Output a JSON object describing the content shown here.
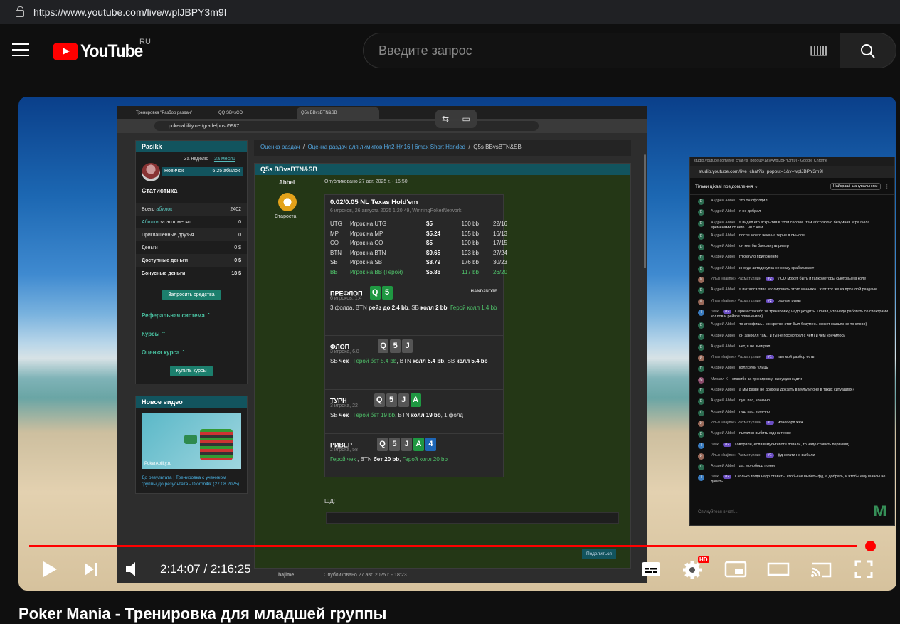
{
  "browser": {
    "url": "https://www.youtube.com/live/wplJBPY3m9I"
  },
  "header": {
    "logo": "YouTube",
    "region": "RU",
    "search_placeholder": "Введите запрос"
  },
  "video": {
    "title": "Poker Mania - Тренировка для младшей группы",
    "current_time": "2:14:07",
    "duration": "2:16:25",
    "time_display": "2:14:07 / 2:16:25",
    "progress_fraction": 0.984,
    "hd_badge": "HD"
  },
  "screen": {
    "tabs": [
      "Тренировка \"Разбор раздач\"",
      "QQ SBvsCO",
      "Q5s BBvsBTN&SB"
    ],
    "address": "pokerability.net/grade/post/5987",
    "profile": {
      "name": "Pasikk",
      "period_week": "За неделю",
      "period_month": "За месяц",
      "rank": "Новичок",
      "abilok": "6.25 абилок",
      "stats_title": "Статистика",
      "stats": [
        {
          "label": "Всего абилок",
          "value": "2402"
        },
        {
          "label": "Абилки за этот месяц",
          "value": "0"
        },
        {
          "label": "Приглашенные друзья",
          "value": "0"
        },
        {
          "label": "Деньги",
          "value": "0 $"
        },
        {
          "label": "Доступные деньги",
          "value": "0 $"
        },
        {
          "label": "Бонусные деньги",
          "value": "18 $"
        }
      ],
      "request_btn": "Запросить средства",
      "menu": [
        "Реферальная система",
        "Курсы",
        "Оценка курса"
      ],
      "buy_btn": "Купить курсы"
    },
    "newvideo": {
      "heading": "Новое видео",
      "logo_text": "PokerAbility.ru",
      "caption": "До результата | Тренировка с учеником группы До результата - Dioron4ik (27.08.2025)"
    },
    "breadcrumb": [
      "Оценка раздач",
      "Оценка раздач для лимитов Нл2-Нл16 | 6max Short Handed",
      "Q5s BBvsBTN&SB"
    ],
    "post": {
      "title": "Q5s BBvsBTN&SB",
      "author": "Abbel",
      "author_role": "Староста",
      "published": "Опубликовано 27 авг. 2025 г. - 16:50",
      "hand_title": "0.02/0.05 NL Texas Hold'em",
      "hand_info": "6 игроков, 26 августа 2025 1:20:49, WinningPokerNetwork",
      "players": [
        {
          "pos": "UTG",
          "name": "Игрок на UTG",
          "stack": "$5",
          "bb": "100 bb",
          "ratio": "22/16"
        },
        {
          "pos": "MP",
          "name": "Игрок на MP",
          "stack": "$5.24",
          "bb": "105 bb",
          "ratio": "16/13"
        },
        {
          "pos": "CO",
          "name": "Игрок на CO",
          "stack": "$5",
          "bb": "100 bb",
          "ratio": "17/15"
        },
        {
          "pos": "BTN",
          "name": "Игрок на BTN",
          "stack": "$9.65",
          "bb": "193 bb",
          "ratio": "27/24"
        },
        {
          "pos": "SB",
          "name": "Игрок на SB",
          "stack": "$8.79",
          "bb": "176 bb",
          "ratio": "30/23"
        },
        {
          "pos": "BB",
          "name": "Игрок на BB (Герой)",
          "stack": "$5.86",
          "bb": "117 bb",
          "ratio": "26/20"
        }
      ],
      "preflop": {
        "label": "ПРЕФЛОП",
        "sub": "6 игроков, 1.4",
        "cards": [
          "Q",
          "5"
        ],
        "brand": "HAND2NOTE",
        "action": "3 фолда, BTN рейз до 2.4 bb, SB колл 2 bb, Герой колл 1.4 bb"
      },
      "flop": {
        "label": "ФЛОП",
        "sub": "3 игрока, 6.8",
        "cards": [
          "Q",
          "5",
          "J"
        ],
        "action": "SB чек , Герой бет 5.4 bb, BTN колл 5.4 bb, SB колл 5.4 bb"
      },
      "turn": {
        "label": "ТУРН",
        "sub": "3 игрока, 22",
        "cards": [
          "Q",
          "5",
          "J",
          "A"
        ],
        "action": "SB чек , Герой бет 19 bb, BTN колл 19 bb, 1 фолд"
      },
      "river": {
        "label": "РИВЕР",
        "sub": "2 игрока, 58",
        "cards": [
          "Q",
          "5",
          "J",
          "A",
          "4"
        ],
        "action": "Герой чек , BTN бет 20 bb, Герой колл 20 bb"
      },
      "sd_label": "ШД:",
      "share_btn": "Поделиться",
      "next_author": "hajime",
      "next_published": "Опубликовано 27 авг. 2025 г. - 18:23"
    }
  },
  "chat": {
    "window_title": "studio.youtube.com/live_chat?is_popout=1&v=wplJBPY3m9I - Google Chrome",
    "url": "studio.youtube.com/live_chat?is_popout=1&v=wplJBPY3m9I",
    "filter": "Тільки цікаві повідомлення",
    "top_btn": "Найкращі шанувальники",
    "input_placeholder": "Спілкуйтеся в чаті...",
    "messages": [
      {
        "i": "D",
        "a": "Андрей Abbel",
        "t": "это он сфолдил"
      },
      {
        "i": "D",
        "a": "Андрей Abbel",
        "t": "я не добрал"
      },
      {
        "i": "D",
        "a": "Андрей Abbel",
        "t": "я видел его вскрытия в этой сессии.. там абсолютно безумная игра была временами от него.. ни с чем"
      },
      {
        "i": "D",
        "a": "Андрей Abbel",
        "t": "после моего чека на терне в смысле"
      },
      {
        "i": "D",
        "a": "Андрей Abbel",
        "t": "он мог бы блефануть ривер"
      },
      {
        "i": "D",
        "a": "Андрей Abbel",
        "t": "глюкнуло приложение"
      },
      {
        "i": "D",
        "a": "Андрей Abbel",
        "t": "иногда автодокупка не сразу срабатывает"
      },
      {
        "i": "И",
        "a": "Илья «hajime» Рахматуллин",
        "b": "#2",
        "t": "у CO может быть и гапкометоры сьютовые в коле"
      },
      {
        "i": "D",
        "a": "Андрей Abbel",
        "t": "я пытался типа изолировать этого маньяка.. этот тот же из прошлой раздачи"
      },
      {
        "i": "И",
        "a": "Илья «hajime» Рахматуллин",
        "b": "#2",
        "t": "разные румы"
      },
      {
        "i": "I",
        "a": "I9sik",
        "b": "#2",
        "t": "Сергей спасибо за тренировку, надо уходить. Понял, что надо работать со спектрами коллов и рейзов оппонентов)"
      },
      {
        "i": "D",
        "a": "Андрей Abbel",
        "t": "то агрофишь.. конкретно этот был безумен.. может маньяк не то слово)"
      },
      {
        "i": "D",
        "a": "Андрей Abbel",
        "t": "он закоолл там.. и ты не посмотрел с чем) и чем кончилось"
      },
      {
        "i": "D",
        "a": "Андрей Abbel",
        "t": "нет, я не выиграл"
      },
      {
        "i": "И",
        "a": "Илья «hajime» Рахматуллин",
        "b": "#1",
        "t": "там мой разбор есть"
      },
      {
        "i": "D",
        "a": "Андрей Abbel",
        "t": "колл этой улицы"
      },
      {
        "i": "M",
        "a": "Михаил К",
        "t": "спасибо за тренировку, вынужден идти"
      },
      {
        "i": "D",
        "a": "Андрей Abbel",
        "t": "а мы разве не должны докзать в мультипоне в таких ситуациях?"
      },
      {
        "i": "D",
        "a": "Андрей Abbel",
        "t": "пуш пас, конечно"
      },
      {
        "i": "D",
        "a": "Андрей Abbel",
        "t": "пуш пас, конечно"
      },
      {
        "i": "И",
        "a": "Илья «hajime» Рахматуллин",
        "b": "#1",
        "t": "моноборд жеж"
      },
      {
        "i": "D",
        "a": "Андрей Abbel",
        "t": "пытался выбить фд на терне"
      },
      {
        "i": "I",
        "a": "I9sik",
        "b": "#2",
        "t": "Говорили, если в мультипоте попали, то надо ставить первыми)"
      },
      {
        "i": "И",
        "a": "Илья «hajime» Рахматуллин",
        "b": "#1",
        "t": "фд кстати не выбили"
      },
      {
        "i": "D",
        "a": "Андрей Abbel",
        "t": "да, моноборд понял"
      },
      {
        "i": "I",
        "a": "I9sik",
        "b": "#2",
        "t": "Сколько тогда надо ставить, чтобы не выбить фд, а добрать, и чтобы ему шансы не давать"
      }
    ]
  }
}
